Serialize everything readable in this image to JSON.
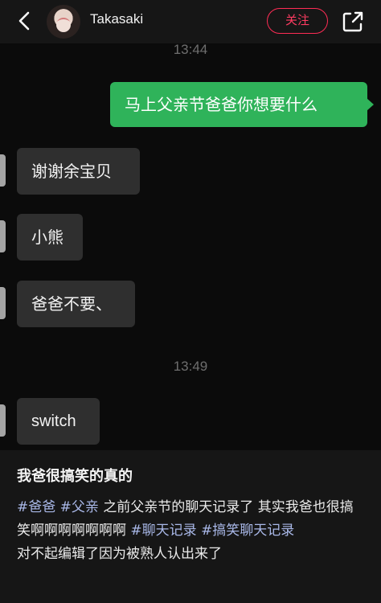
{
  "header": {
    "username": "Takasaki",
    "follow_label": "关注"
  },
  "chat": {
    "time_top": "13:44",
    "time_mid": "13:49",
    "outgoing": "马上父亲节爸爸你想要什么",
    "incoming": [
      "谢谢余宝贝",
      "小熊",
      "爸爸不要、",
      "switch"
    ]
  },
  "post": {
    "title": "我爸很搞笑的真的",
    "tags": [
      "#爸爸",
      "#父亲",
      "#聊天记录",
      "#搞笑聊天记录"
    ],
    "text_1": "之前父亲节的聊天记录了 其实我爸也很搞笑啊啊啊啊啊啊啊",
    "text_2": "对不起编辑了因为被熟人认出来了"
  },
  "icons": [
    "back-icon",
    "share-icon"
  ],
  "colors": {
    "accent": "#ff2c55",
    "bubble_out": "#2fb35a",
    "tag": "#a9b8e8"
  }
}
